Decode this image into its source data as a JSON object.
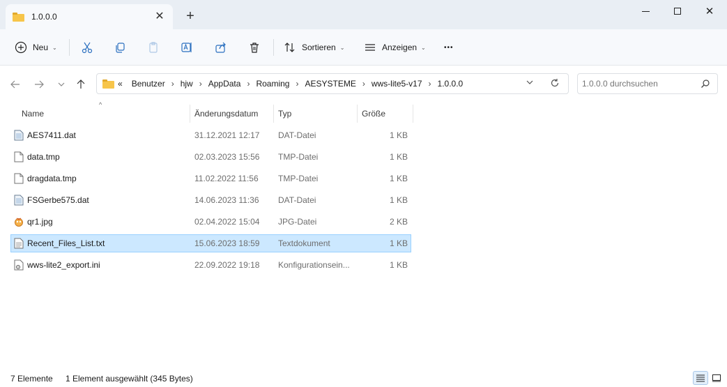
{
  "window": {
    "tab_title": "1.0.0.0",
    "new_tab": "+",
    "close_tab": "✕",
    "close_window": "✕"
  },
  "toolbar": {
    "new_label": "Neu",
    "sort_label": "Sortieren",
    "view_label": "Anzeigen",
    "more_label": "•••"
  },
  "address": {
    "overflow": "«",
    "crumbs": [
      "Benutzer",
      "hjw",
      "AppData",
      "Roaming",
      "AESYSTEME",
      "wws-lite5-v17",
      "1.0.0.0"
    ],
    "separator": "›"
  },
  "search": {
    "placeholder": "1.0.0.0 durchsuchen"
  },
  "columns": {
    "name": "Name",
    "date": "Änderungsdatum",
    "type": "Typ",
    "size": "Größe"
  },
  "files": [
    {
      "name": "AES7411.dat",
      "date": "31.12.2021 12:17",
      "type": "DAT-Datei",
      "size": "1 KB",
      "icon": "dat-file-icon"
    },
    {
      "name": "data.tmp",
      "date": "02.03.2023 15:56",
      "type": "TMP-Datei",
      "size": "1 KB",
      "icon": "generic-file-icon"
    },
    {
      "name": "dragdata.tmp",
      "date": "11.02.2022 11:56",
      "type": "TMP-Datei",
      "size": "1 KB",
      "icon": "generic-file-icon"
    },
    {
      "name": "FSGerbe575.dat",
      "date": "14.06.2023 11:36",
      "type": "DAT-Datei",
      "size": "1 KB",
      "icon": "dat-file-icon"
    },
    {
      "name": "qr1.jpg",
      "date": "02.04.2022 15:04",
      "type": "JPG-Datei",
      "size": "2 KB",
      "icon": "image-file-icon"
    },
    {
      "name": "Recent_Files_List.txt",
      "date": "15.06.2023 18:59",
      "type": "Textdokument",
      "size": "1 KB",
      "icon": "text-file-icon",
      "selected": true
    },
    {
      "name": "wws-lite2_export.ini",
      "date": "22.09.2022 19:18",
      "type": "Konfigurationsein...",
      "size": "1 KB",
      "icon": "config-file-icon"
    }
  ],
  "status": {
    "count": "7 Elemente",
    "selection": "1 Element ausgewählt (345 Bytes)"
  },
  "colors": {
    "selection_bg": "#cce8ff",
    "selection_border": "#99d1ff",
    "folder": "#f7c54a"
  }
}
